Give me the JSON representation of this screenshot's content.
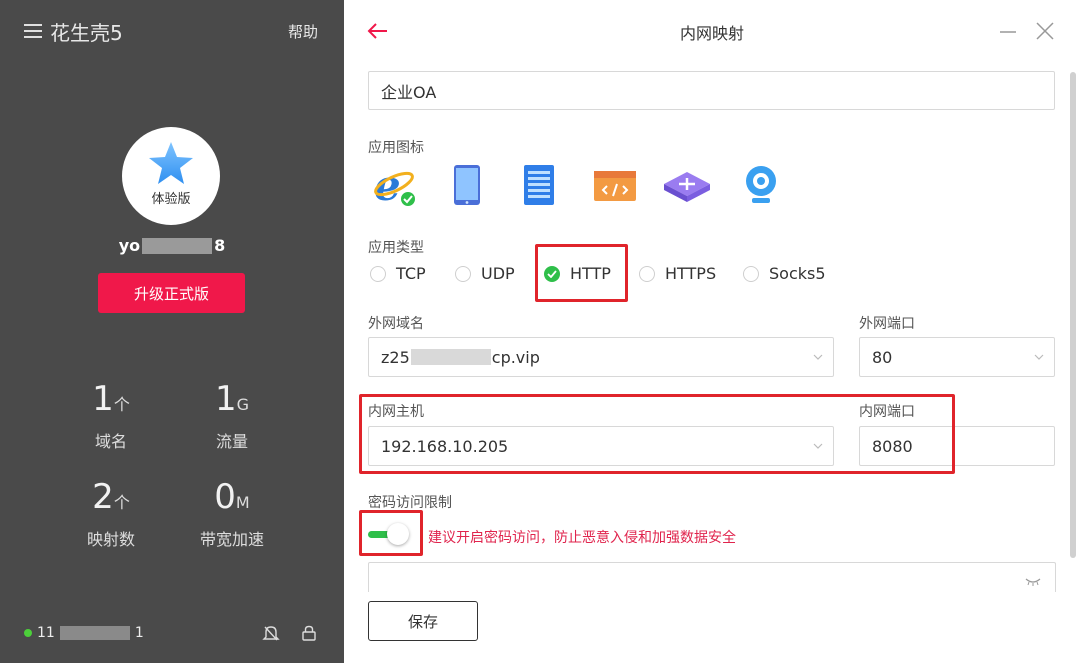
{
  "sidebar": {
    "brand": "花生壳5",
    "help": "帮助",
    "edition": "体验版",
    "username_prefix": "yo",
    "username_suffix": "8",
    "upgrade_label": "升级正式版",
    "stats": [
      {
        "num": "1",
        "unit": "个",
        "label": "域名"
      },
      {
        "num": "1",
        "unit": "G",
        "label": "流量"
      },
      {
        "num": "2",
        "unit": "个",
        "label": "映射数"
      },
      {
        "num": "0",
        "unit": "M",
        "label": "带宽加速"
      }
    ],
    "status_prefix": "11",
    "status_suffix": "1"
  },
  "main": {
    "title": "内网映射",
    "app_name": "企业OA",
    "app_icon_label": "应用图标",
    "app_icons": [
      "ie-icon",
      "tablet-icon",
      "server-icon",
      "code-window-icon",
      "router-icon",
      "webcam-icon"
    ],
    "app_type_label": "应用类型",
    "app_types": [
      "TCP",
      "UDP",
      "HTTP",
      "HTTPS",
      "Socks5"
    ],
    "app_type_selected": "HTTP",
    "ext_domain_label": "外网域名",
    "ext_domain_prefix": "z25",
    "ext_domain_suffix": "cp.vip",
    "ext_port_label": "外网端口",
    "ext_port": "80",
    "int_host_label": "内网主机",
    "int_host": "192.168.10.205",
    "int_port_label": "内网端口",
    "int_port": "8080",
    "pwd_label": "密码访问限制",
    "pwd_enabled": true,
    "pwd_hint": "建议开启密码访问，防止恶意入侵和加强数据安全",
    "save_label": "保存"
  },
  "colors": {
    "sidebar_bg": "#4a4a4a",
    "accent_red": "#f0184a",
    "check_green": "#2fbf4a",
    "highlight_box": "#e0242b"
  }
}
